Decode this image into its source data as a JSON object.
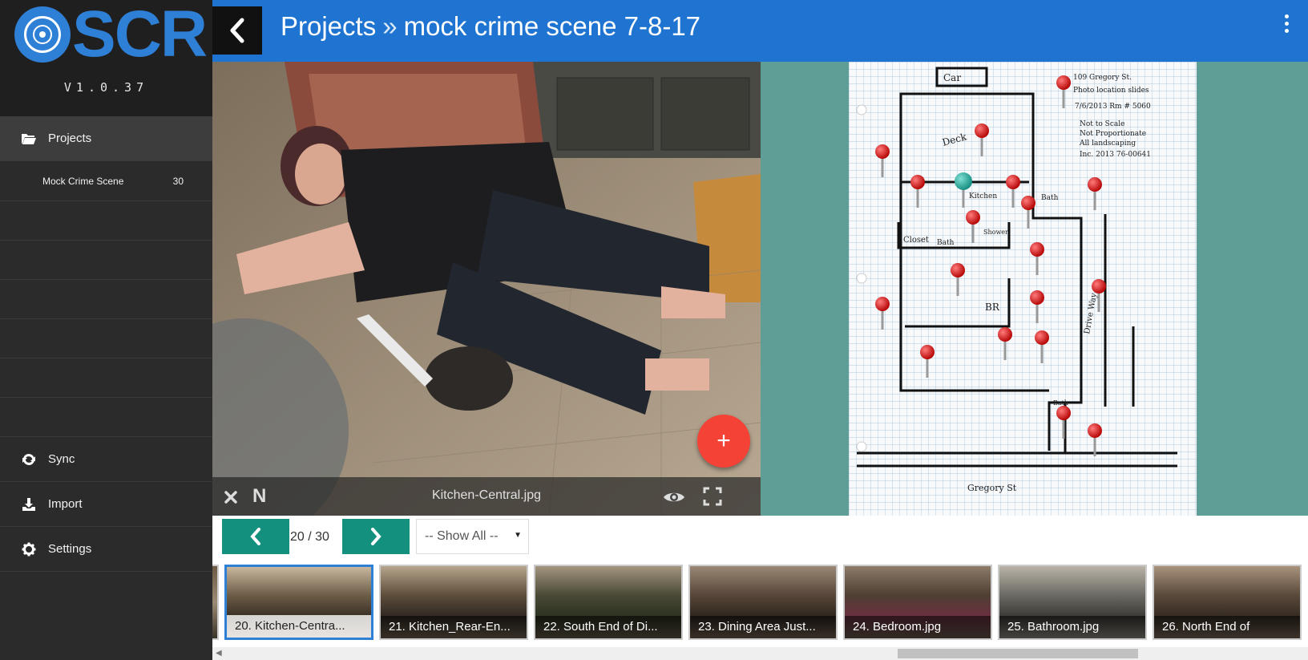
{
  "app": {
    "logo_text": "SCR",
    "version": "V1.0.37"
  },
  "sidebar": {
    "projects_label": "Projects",
    "project_item": {
      "label": "Mock Crime Scene",
      "count": "30"
    },
    "sync_label": "Sync",
    "import_label": "Import",
    "settings_label": "Settings"
  },
  "header": {
    "crumb_root": "Projects",
    "separator": "»",
    "project_title": "mock crime scene 7-8-17",
    "bg_color": "#1e74d0"
  },
  "viewer": {
    "filename": "Kitchen-Central.jpg",
    "compass": "N",
    "add_symbol": "+"
  },
  "controls": {
    "counter": "20 / 30",
    "filter_value": "-- Show All --",
    "accent": "#14907f"
  },
  "thumbnails": [
    {
      "label": "20. Kitchen-Centra..."
    },
    {
      "label": "21. Kitchen_Rear-En..."
    },
    {
      "label": "22. South End of Di..."
    },
    {
      "label": "23. Dining Area Just..."
    },
    {
      "label": "24. Bedroom.jpg"
    },
    {
      "label": "25. Bathroom.jpg"
    },
    {
      "label": "26. North End of"
    }
  ],
  "floorplan": {
    "notes": [
      "109 Gregory St.",
      "Photo location slides",
      "7/6/2013 Rm # 5060",
      "Not to Scale",
      "Not Proportionate",
      "All landscaping",
      "Inc. 2013 76-00641"
    ],
    "room_labels": [
      "Car",
      "Deck",
      "Kitchen",
      "Bath",
      "Closet",
      "Bath",
      "Shower",
      "BR",
      "Drive Way",
      "Bath",
      "Gregory St"
    ]
  }
}
